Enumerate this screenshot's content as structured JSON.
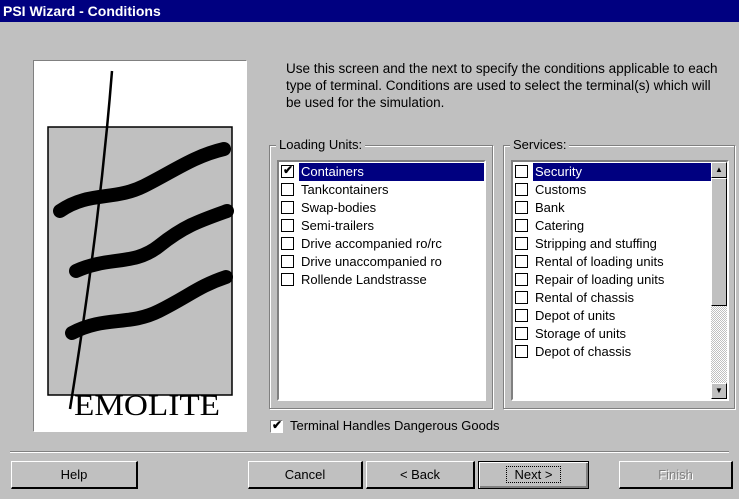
{
  "window": {
    "title": "PSI Wizard - Conditions"
  },
  "logo": {
    "text": "EMOLITE"
  },
  "intro_text": "Use this screen and the next to specify the conditions applicable to each type of terminal. Conditions are used to select the terminal(s) which will be used for the simulation.",
  "loading_units": {
    "label": "Loading Units:",
    "items": [
      {
        "label": "Containers",
        "checked": true,
        "selected": true
      },
      {
        "label": "Tankcontainers",
        "checked": false,
        "selected": false
      },
      {
        "label": "Swap-bodies",
        "checked": false,
        "selected": false
      },
      {
        "label": "Semi-trailers",
        "checked": false,
        "selected": false
      },
      {
        "label": "Drive accompanied ro/rc",
        "checked": false,
        "selected": false
      },
      {
        "label": "Drive unaccompanied ro",
        "checked": false,
        "selected": false
      },
      {
        "label": "Rollende Landstrasse",
        "checked": false,
        "selected": false
      }
    ]
  },
  "services": {
    "label": "Services:",
    "items": [
      {
        "label": "Security",
        "checked": false,
        "selected": true
      },
      {
        "label": "Customs",
        "checked": false,
        "selected": false
      },
      {
        "label": "Bank",
        "checked": false,
        "selected": false
      },
      {
        "label": "Catering",
        "checked": false,
        "selected": false
      },
      {
        "label": "Stripping and stuffing",
        "checked": false,
        "selected": false
      },
      {
        "label": "Rental of loading units",
        "checked": false,
        "selected": false
      },
      {
        "label": "Repair of loading units",
        "checked": false,
        "selected": false
      },
      {
        "label": "Rental of chassis",
        "checked": false,
        "selected": false
      },
      {
        "label": "Depot of units",
        "checked": false,
        "selected": false
      },
      {
        "label": "Storage of units",
        "checked": false,
        "selected": false
      },
      {
        "label": "Depot of chassis",
        "checked": false,
        "selected": false
      }
    ]
  },
  "dangerous_goods": {
    "label": "Terminal Handles Dangerous Goods",
    "checked": true
  },
  "buttons": {
    "help": "Help",
    "cancel": "Cancel",
    "back": "< Back",
    "next": "Next >",
    "finish": "Finish"
  },
  "icons": {
    "check": "check-icon",
    "scroll_up": "arrow-up-icon",
    "scroll_down": "arrow-down-icon"
  }
}
